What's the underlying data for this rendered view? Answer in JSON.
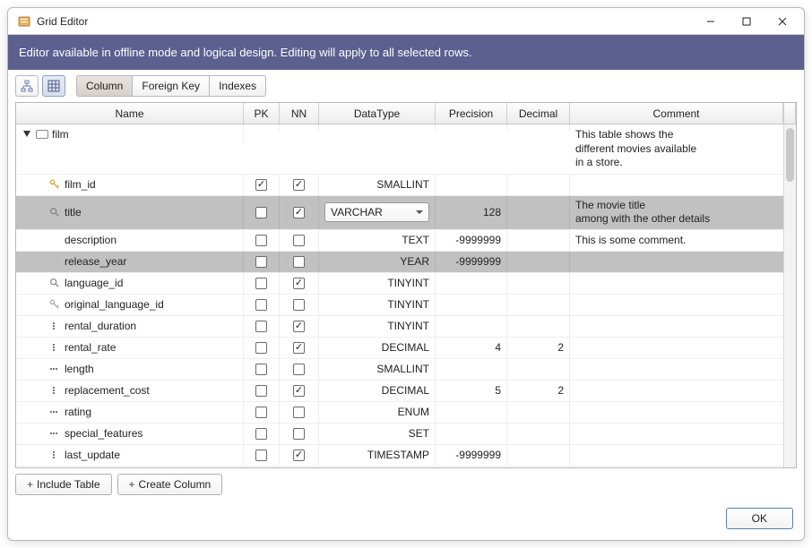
{
  "window": {
    "title": "Grid Editor"
  },
  "banner": "Editor available in offline mode and logical design. Editing will apply to all selected rows.",
  "tabs": {
    "column": "Column",
    "foreign_key": "Foreign Key",
    "indexes": "Indexes"
  },
  "headers": {
    "name": "Name",
    "pk": "PK",
    "nn": "NN",
    "datatype": "DataType",
    "precision": "Precision",
    "decimal": "Decimal",
    "comment": "Comment"
  },
  "table": {
    "name": "film",
    "comment": "This table shows the\ndifferent movies available\nin a store."
  },
  "rows": [
    {
      "icon": "key",
      "name": "film_id",
      "pk": true,
      "nn": true,
      "datatype": "SMALLINT",
      "precision": "",
      "decimal": "",
      "comment": "",
      "sel": false,
      "combo": false
    },
    {
      "icon": "mag",
      "name": "title",
      "pk": false,
      "nn": true,
      "datatype": "VARCHAR",
      "precision": "128",
      "decimal": "",
      "comment": "The movie title\namong with the other details",
      "sel": true,
      "combo": true
    },
    {
      "icon": "",
      "name": "description",
      "pk": false,
      "nn": false,
      "datatype": "TEXT",
      "precision": "-9999999",
      "decimal": "",
      "comment": "This is some comment.",
      "sel": false,
      "combo": false
    },
    {
      "icon": "",
      "name": "release_year",
      "pk": false,
      "nn": false,
      "datatype": "YEAR",
      "precision": "-9999999",
      "decimal": "",
      "comment": "",
      "sel": true,
      "combo": false
    },
    {
      "icon": "mag",
      "name": "language_id",
      "pk": false,
      "nn": true,
      "datatype": "TINYINT",
      "precision": "",
      "decimal": "",
      "comment": "",
      "sel": false,
      "combo": false
    },
    {
      "icon": "key2",
      "name": "original_language_id",
      "pk": false,
      "nn": false,
      "datatype": "TINYINT",
      "precision": "",
      "decimal": "",
      "comment": "",
      "sel": false,
      "combo": false
    },
    {
      "icon": "dots",
      "name": "rental_duration",
      "pk": false,
      "nn": true,
      "datatype": "TINYINT",
      "precision": "",
      "decimal": "",
      "comment": "",
      "sel": false,
      "combo": false
    },
    {
      "icon": "dots",
      "name": "rental_rate",
      "pk": false,
      "nn": true,
      "datatype": "DECIMAL",
      "precision": "4",
      "decimal": "2",
      "comment": "",
      "sel": false,
      "combo": false
    },
    {
      "icon": "hdots",
      "name": "length",
      "pk": false,
      "nn": false,
      "datatype": "SMALLINT",
      "precision": "",
      "decimal": "",
      "comment": "",
      "sel": false,
      "combo": false
    },
    {
      "icon": "dots",
      "name": "replacement_cost",
      "pk": false,
      "nn": true,
      "datatype": "DECIMAL",
      "precision": "5",
      "decimal": "2",
      "comment": "",
      "sel": false,
      "combo": false
    },
    {
      "icon": "hdots",
      "name": "rating",
      "pk": false,
      "nn": false,
      "datatype": "ENUM",
      "precision": "",
      "decimal": "",
      "comment": "",
      "sel": false,
      "combo": false
    },
    {
      "icon": "hdots",
      "name": "special_features",
      "pk": false,
      "nn": false,
      "datatype": "SET",
      "precision": "",
      "decimal": "",
      "comment": "",
      "sel": false,
      "combo": false
    },
    {
      "icon": "dots",
      "name": "last_update",
      "pk": false,
      "nn": true,
      "datatype": "TIMESTAMP",
      "precision": "-9999999",
      "decimal": "",
      "comment": "",
      "sel": false,
      "combo": false
    }
  ],
  "footer": {
    "include_table": "Include Table",
    "create_column": "Create Column",
    "ok": "OK"
  }
}
